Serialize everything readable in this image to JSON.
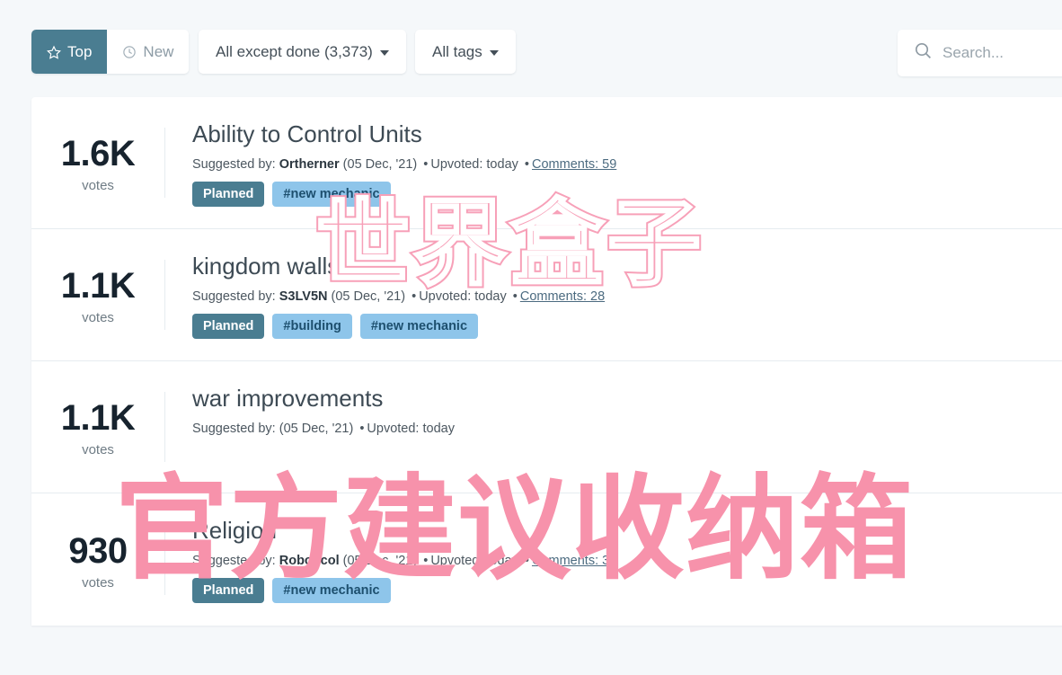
{
  "toolbar": {
    "sort_tabs": [
      {
        "label": "Top",
        "icon": "star-icon",
        "active": true
      },
      {
        "label": "New",
        "icon": "clock-icon",
        "active": false
      }
    ],
    "status_filter": {
      "label": "All except done (3,373)",
      "icon": "chevron-down-icon"
    },
    "tag_filter": {
      "label": "All tags",
      "icon": "chevron-down-icon"
    },
    "search": {
      "value": "",
      "placeholder": "Search...",
      "icon": "search-icon"
    }
  },
  "posts": [
    {
      "votes": "1.6K",
      "votes_label": "votes",
      "title": "Ability to Control Units",
      "meta_prefix": "Suggested by:",
      "author": "Ortherner",
      "date": "(05 Dec, '21)",
      "upvoted": "Upvoted: today",
      "comments": "Comments: 59",
      "status": "Planned",
      "tags": [
        "#new mechanic"
      ]
    },
    {
      "votes": "1.1K",
      "votes_label": "votes",
      "title": "kingdom walls",
      "meta_prefix": "Suggested by:",
      "author": "S3LV5N",
      "date": "(05 Dec, '21)",
      "upvoted": "Upvoted: today",
      "comments": "Comments: 28",
      "status": "Planned",
      "tags": [
        "#building",
        "#new mechanic"
      ]
    },
    {
      "votes": "1.1K",
      "votes_label": "votes",
      "title": "war improvements",
      "meta_prefix": "Suggested by:",
      "author": "",
      "date": "(05 Dec, '21)",
      "upvoted": "Upvoted: today",
      "comments": "",
      "status": "",
      "tags": []
    },
    {
      "votes": "930",
      "votes_label": "votes",
      "title": "Religion",
      "meta_prefix": "Suggested by:",
      "author": "Roboticol",
      "date": "(05 Dec, '21)",
      "upvoted": "Upvoted: today",
      "comments": "Comments: 33",
      "status": "Planned",
      "tags": [
        "#new mechanic"
      ]
    }
  ],
  "watermarks": {
    "top": "世界盒子",
    "bottom": "官方建议收纳箱",
    "color": "#f792ab"
  },
  "colors": {
    "page_background": "#f5f8fa",
    "accent": "#4a7d91",
    "tag": "#8ec5ea",
    "watermark_pink": "#f792ab",
    "title": "#3d4a54"
  }
}
